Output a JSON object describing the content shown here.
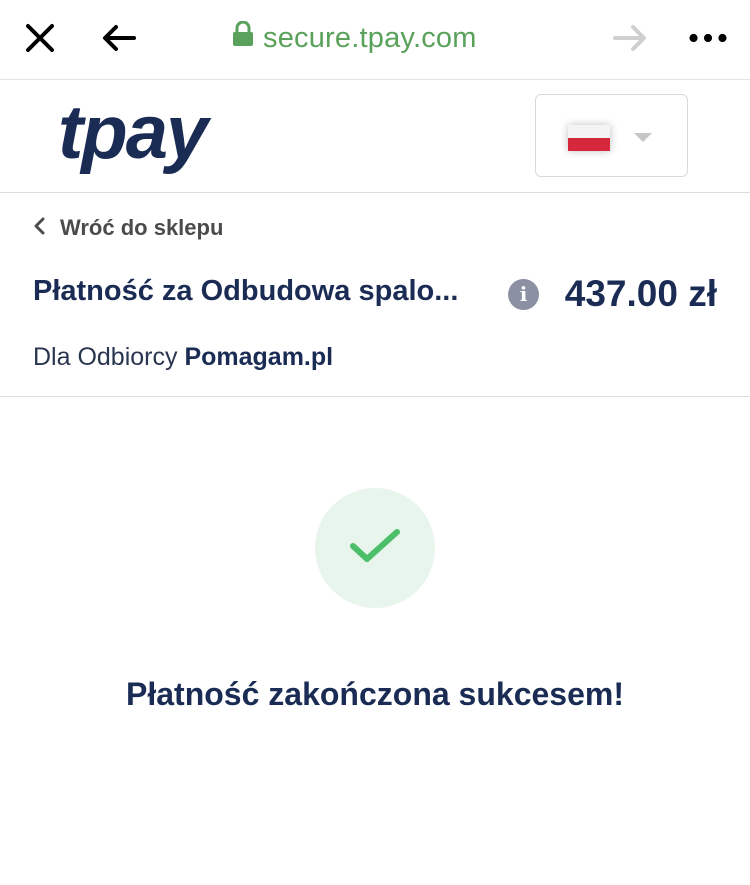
{
  "browser": {
    "close_icon": "close-icon",
    "back_icon": "arrow-left-icon",
    "forward_icon": "arrow-right-icon",
    "menu_icon": "more-horizontal-icon",
    "url": "secure.tpay.com",
    "lock_icon": "lock-icon",
    "url_color": "#5aa25b"
  },
  "header": {
    "logo_text": "tpay",
    "language": {
      "flag": "poland-flag",
      "caret_icon": "caret-down-icon"
    }
  },
  "order": {
    "back_label": "Wróć do sklepu",
    "title": "Płatność za Odbudowa spalo...",
    "info_icon": "info-icon",
    "amount": "437.00 zł",
    "recipient_prefix": "Dla Odbiorcy",
    "recipient_name": "Pomagam.pl"
  },
  "status": {
    "icon": "checkmark-icon",
    "message": "Płatność zakończona sukcesem!",
    "success_color": "#4cbf6a"
  },
  "colors": {
    "brand": "#1a2b54",
    "success_bg": "#e7f5ec"
  }
}
